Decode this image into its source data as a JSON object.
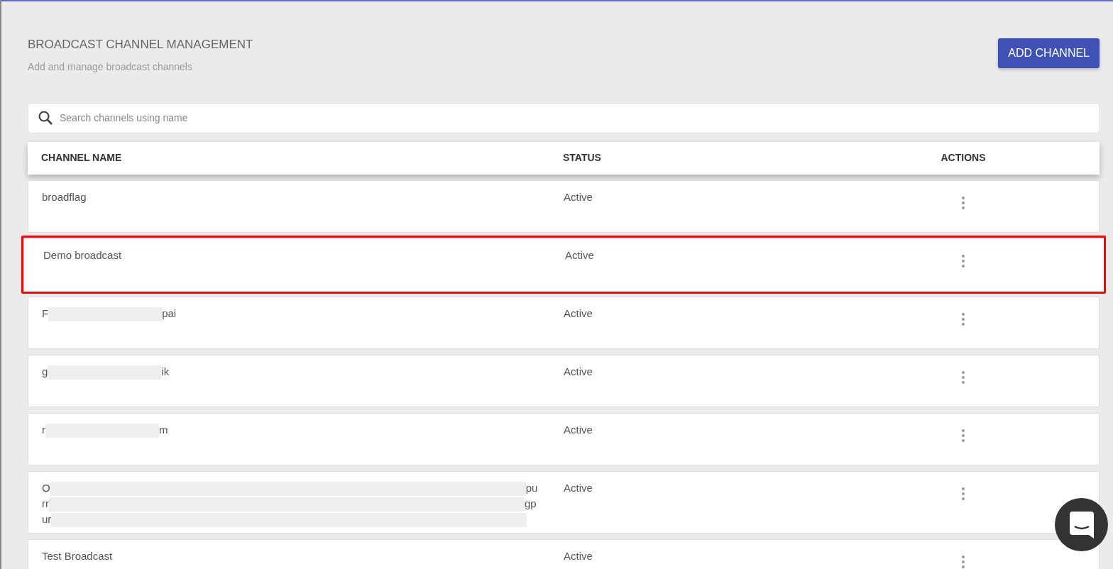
{
  "page": {
    "title": "BROADCAST CHANNEL MANAGEMENT",
    "subtitle": "Add and manage broadcast channels",
    "add_button": "ADD CHANNEL"
  },
  "search": {
    "placeholder": "Search channels using name"
  },
  "table": {
    "columns": [
      "CHANNEL NAME",
      "STATUS",
      "ACTIONS"
    ],
    "rows": [
      {
        "name_lines": [
          {
            "start": "broadflag"
          }
        ],
        "status": "Active",
        "highlighted": false
      },
      {
        "name_lines": [
          {
            "start": "Demo broadcast"
          }
        ],
        "status": "Active",
        "highlighted": true
      },
      {
        "name_lines": [
          {
            "start": "F",
            "end": "pai",
            "redacted": true
          }
        ],
        "status": "Active",
        "highlighted": false
      },
      {
        "name_lines": [
          {
            "start": "g",
            "end": "ik",
            "redacted": true
          }
        ],
        "status": "Active",
        "highlighted": false
      },
      {
        "name_lines": [
          {
            "start": "r",
            "end": "m",
            "redacted": true
          }
        ],
        "status": "Active",
        "highlighted": false
      },
      {
        "name_lines": [
          {
            "start": "O",
            "end": "pu",
            "redacted": true
          },
          {
            "start": "rr",
            "end": "gp",
            "redacted": true
          },
          {
            "start": "ur",
            "redacted": true
          }
        ],
        "status": "Active",
        "highlighted": false
      },
      {
        "name_lines": [
          {
            "start": "Test Broadcast"
          }
        ],
        "status": "Active",
        "highlighted": false
      }
    ]
  }
}
